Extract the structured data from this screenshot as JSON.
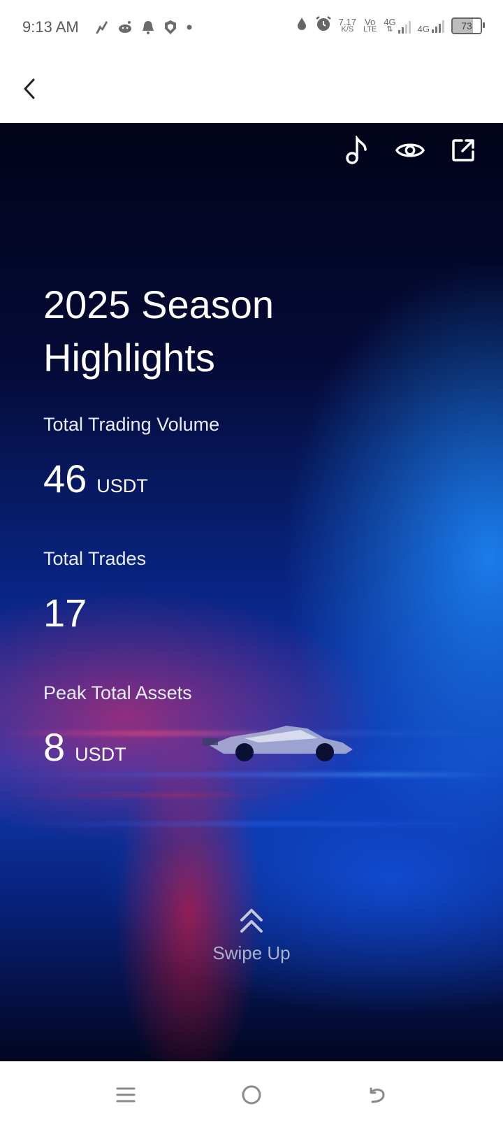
{
  "status_bar": {
    "time": "9:13 AM",
    "net_speed_value": "7.17",
    "net_speed_unit": "K/S",
    "volte_top": "Vo",
    "volte_bottom": "LTE",
    "sim1_label": "4G",
    "sim2_label": "4G",
    "battery_level": "73",
    "left_icons": [
      "signal-app-icon",
      "reddit-icon",
      "bell-icon",
      "shield-icon",
      "dot-icon"
    ],
    "right_icons": [
      "water-drop-icon",
      "alarm-icon"
    ]
  },
  "nav": {
    "back_icon": "chevron-left-icon"
  },
  "hero": {
    "actions": [
      "music-note-icon",
      "eye-icon",
      "share-external-icon"
    ],
    "title": "2025 Season Highlights",
    "stats": [
      {
        "label": "Total Trading Volume",
        "value": "46",
        "unit": "USDT"
      },
      {
        "label": "Total Trades",
        "value": "17",
        "unit": ""
      },
      {
        "label": "Peak Total Assets",
        "value": "8",
        "unit": "USDT"
      }
    ],
    "swipe_label": "Swipe Up",
    "colors": {
      "bg_dark": "#02031a",
      "bg_blue": "#0d3bb8",
      "accent_red": "#ff285a"
    }
  },
  "system_nav": {
    "buttons": [
      "menu-icon",
      "home-icon",
      "back-icon"
    ]
  }
}
